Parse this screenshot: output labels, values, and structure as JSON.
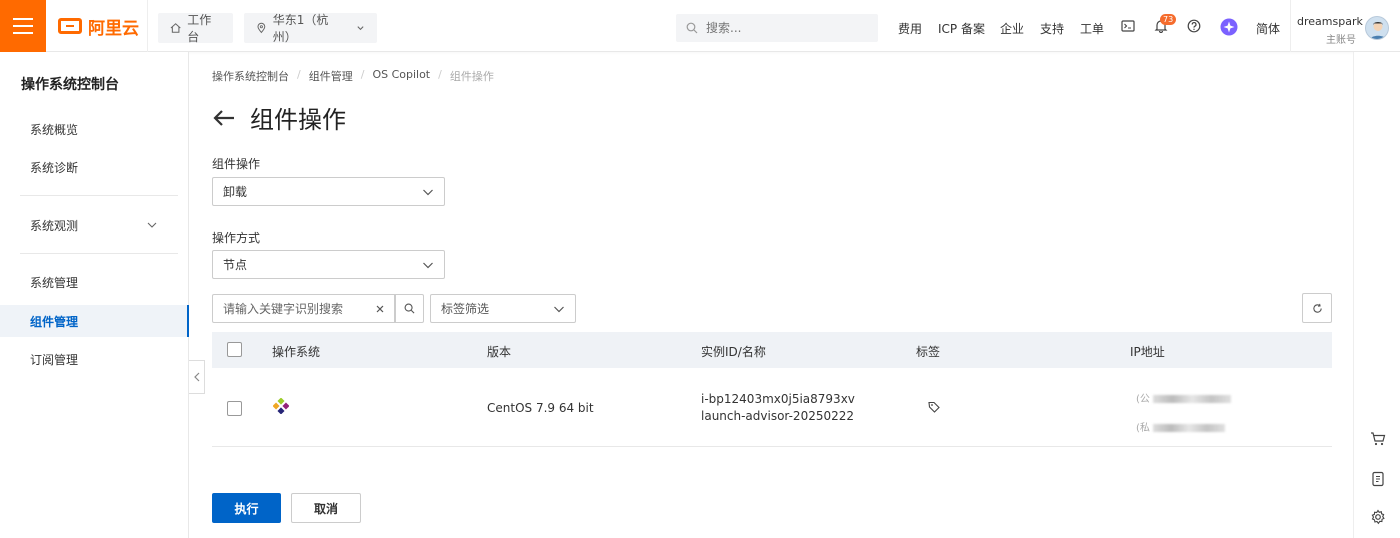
{
  "header": {
    "logo_text": "阿里云",
    "workbench_label": "工作台",
    "region_label": "华东1（杭州）",
    "search_placeholder": "搜索...",
    "nav": [
      "费用",
      "ICP 备案",
      "企业",
      "支持",
      "工单"
    ],
    "notification_count": "73",
    "language_label": "简体",
    "user_name": "dreamspark",
    "user_role": "主账号"
  },
  "sidebar": {
    "title": "操作系统控制台",
    "items": [
      {
        "label": "系统概览"
      },
      {
        "label": "系统诊断"
      },
      {
        "label": "系统观测"
      },
      {
        "label": "系统管理"
      },
      {
        "label": "组件管理"
      },
      {
        "label": "订阅管理"
      }
    ]
  },
  "breadcrumb": [
    "操作系统控制台",
    "组件管理",
    "OS Copilot",
    "组件操作"
  ],
  "page_title": "组件操作",
  "form": {
    "op_label": "组件操作",
    "op_value": "卸载",
    "mode_label": "操作方式",
    "mode_value": "节点"
  },
  "filter": {
    "search_placeholder": "请输入关键字识别搜索",
    "tag_filter_label": "标签筛选"
  },
  "table": {
    "columns": [
      "操作系统",
      "版本",
      "实例ID/名称",
      "标签",
      "IP地址"
    ],
    "rows": [
      {
        "version": "CentOS  7.9 64 bit",
        "instance_id": "i-bp12403mx0j5ia8793xv",
        "instance_name": "launch-advisor-20250222",
        "ip_public_prefix": "(公",
        "ip_private_prefix": "(私"
      }
    ]
  },
  "actions": {
    "execute_label": "执行",
    "cancel_label": "取消"
  },
  "colors": {
    "brand": "#ff6a00",
    "primary": "#0064c8"
  }
}
